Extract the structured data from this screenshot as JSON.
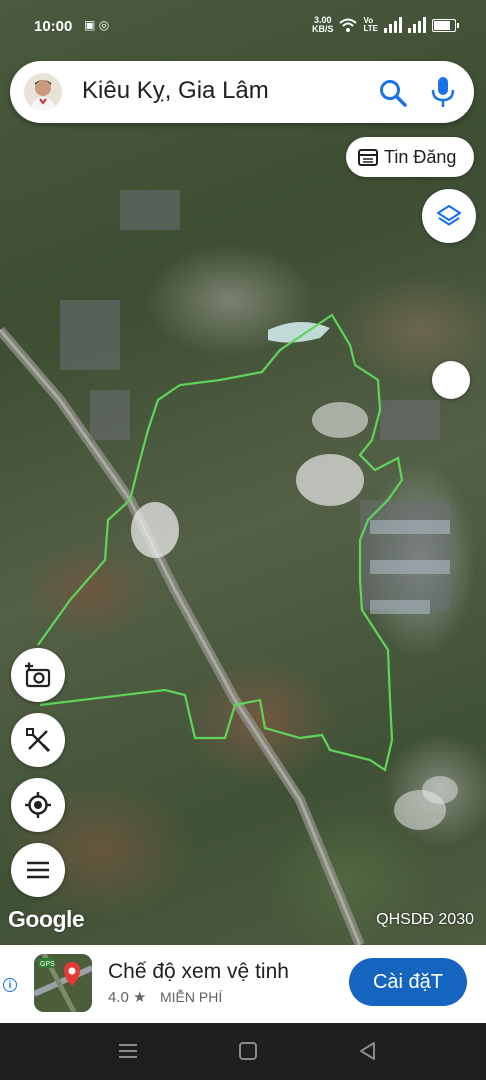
{
  "status_bar": {
    "time": "10:00",
    "left_icons": [
      "zalo-icon",
      "instagram-icon"
    ],
    "net_speed_value": "3.00",
    "net_speed_unit": "KB/S",
    "right_icons": [
      "wifi-icon",
      "volte-icon",
      "signal-icon",
      "signal-icon",
      "battery-icon"
    ]
  },
  "search": {
    "query": "Kiêu Kỵ, Gia Lâm",
    "search_icon": "search-icon",
    "mic_icon": "mic-icon"
  },
  "map": {
    "listing_button_label": "Tin Đăng",
    "logo": "Google",
    "plan_label": "QHSDĐ 2030",
    "boundary_color": "#5fd45a"
  },
  "controls": {
    "left": [
      "camera-add-icon",
      "ruler-tool-icon",
      "my-location-icon",
      "menu-icon"
    ],
    "right": [
      "layers-icon"
    ]
  },
  "ad": {
    "title": "Chế độ xem vệ tinh",
    "rating": "4.0 ★",
    "price": "MIỄN PHÍ",
    "install_label": "Cài đặT",
    "accent": "#1565c0"
  }
}
